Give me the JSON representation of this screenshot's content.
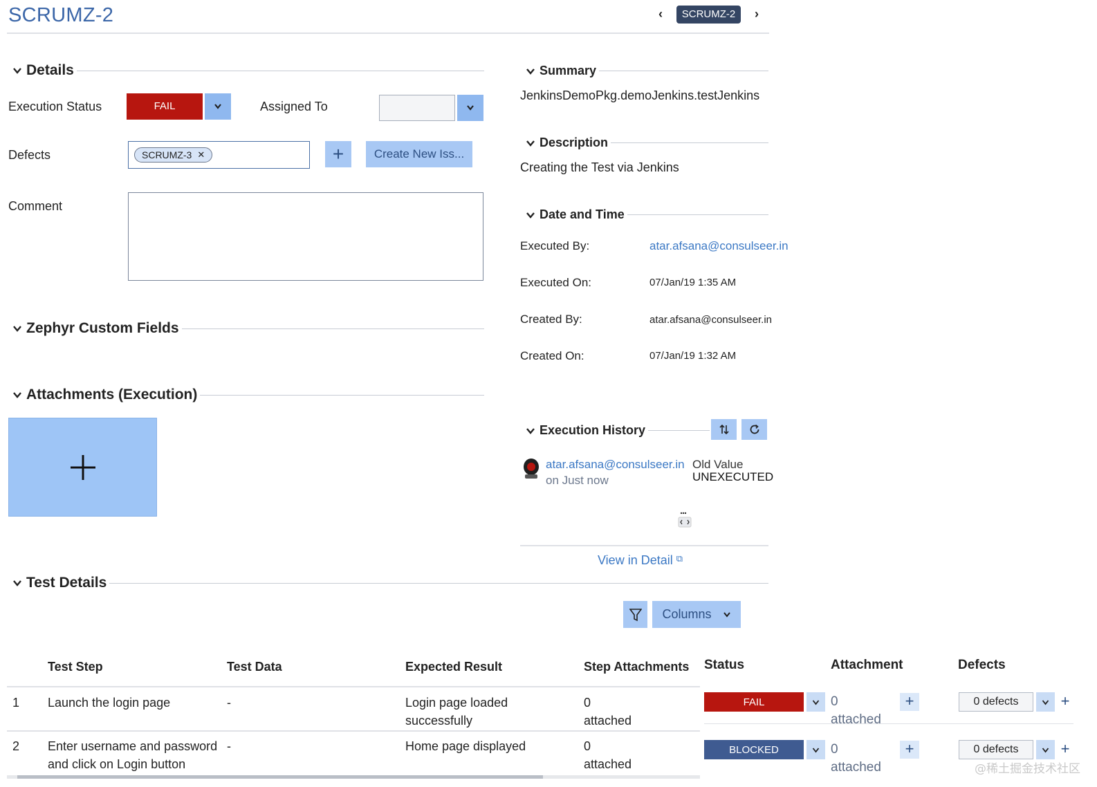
{
  "header": {
    "title": "SCRUMZ-2",
    "issue_key": "SCRUMZ-2",
    "prev_icon": "chevron-left-icon",
    "next_icon": "chevron-right-icon"
  },
  "details": {
    "section_label": "Details",
    "execution_status_label": "Execution Status",
    "execution_status_value": "FAIL",
    "assigned_to_label": "Assigned To",
    "assigned_to_value": "",
    "defects_label": "Defects",
    "defect_tag": "SCRUMZ-3",
    "create_issue_label": "Create New Iss...",
    "comment_label": "Comment",
    "comment_value": ""
  },
  "summary": {
    "section_label": "Summary",
    "text": "JenkinsDemoPkg.demoJenkins.testJenkins"
  },
  "description": {
    "section_label": "Description",
    "text": "Creating the Test via Jenkins"
  },
  "date_time": {
    "section_label": "Date and Time",
    "executed_by_label": "Executed By:",
    "executed_by_value": "atar.afsana@consulseer.in",
    "executed_on_label": "Executed On:",
    "executed_on_value": "07/Jan/19 1:35 AM",
    "created_by_label": "Created By:",
    "created_by_value": "atar.afsana@consulseer.in",
    "created_on_label": "Created On:",
    "created_on_value": "07/Jan/19 1:32 AM"
  },
  "custom_fields": {
    "section_label": "Zephyr Custom Fields"
  },
  "attachments": {
    "section_label": "Attachments (Execution)"
  },
  "history": {
    "section_label": "Execution History",
    "user": "atar.afsana@consulseer.in",
    "when": "on Just now",
    "old_value_label": "Old Value",
    "old_value": "UNEXECUTED",
    "view_detail_label": "View in Detail"
  },
  "test_details": {
    "section_label": "Test Details",
    "columns_label": "Columns",
    "headers": {
      "step": "Test Step",
      "data": "Test Data",
      "expected": "Expected Result",
      "step_attachments": "Step Attachments",
      "status": "Status",
      "attachment": "Attachment",
      "defects": "Defects"
    },
    "rows": [
      {
        "num": "1",
        "step": "Launch the login page",
        "data": "-",
        "expected": "Login page loaded successfully",
        "step_attachments": "0 attached",
        "status": "FAIL",
        "attachment": "0 attached",
        "defects": "0 defects"
      },
      {
        "num": "2",
        "step": "Enter username and password and click on Login button",
        "data": "-",
        "expected": "Home page displayed",
        "step_attachments": "0 attached",
        "status": "BLOCKED",
        "attachment": "0 attached",
        "defects": "0 defects"
      }
    ]
  },
  "colors": {
    "fail": "#b7160f",
    "blocked": "#3f5b91",
    "accent": "#8fb8ef",
    "link": "#3b78c4"
  },
  "watermark": "@稀土掘金技术社区"
}
